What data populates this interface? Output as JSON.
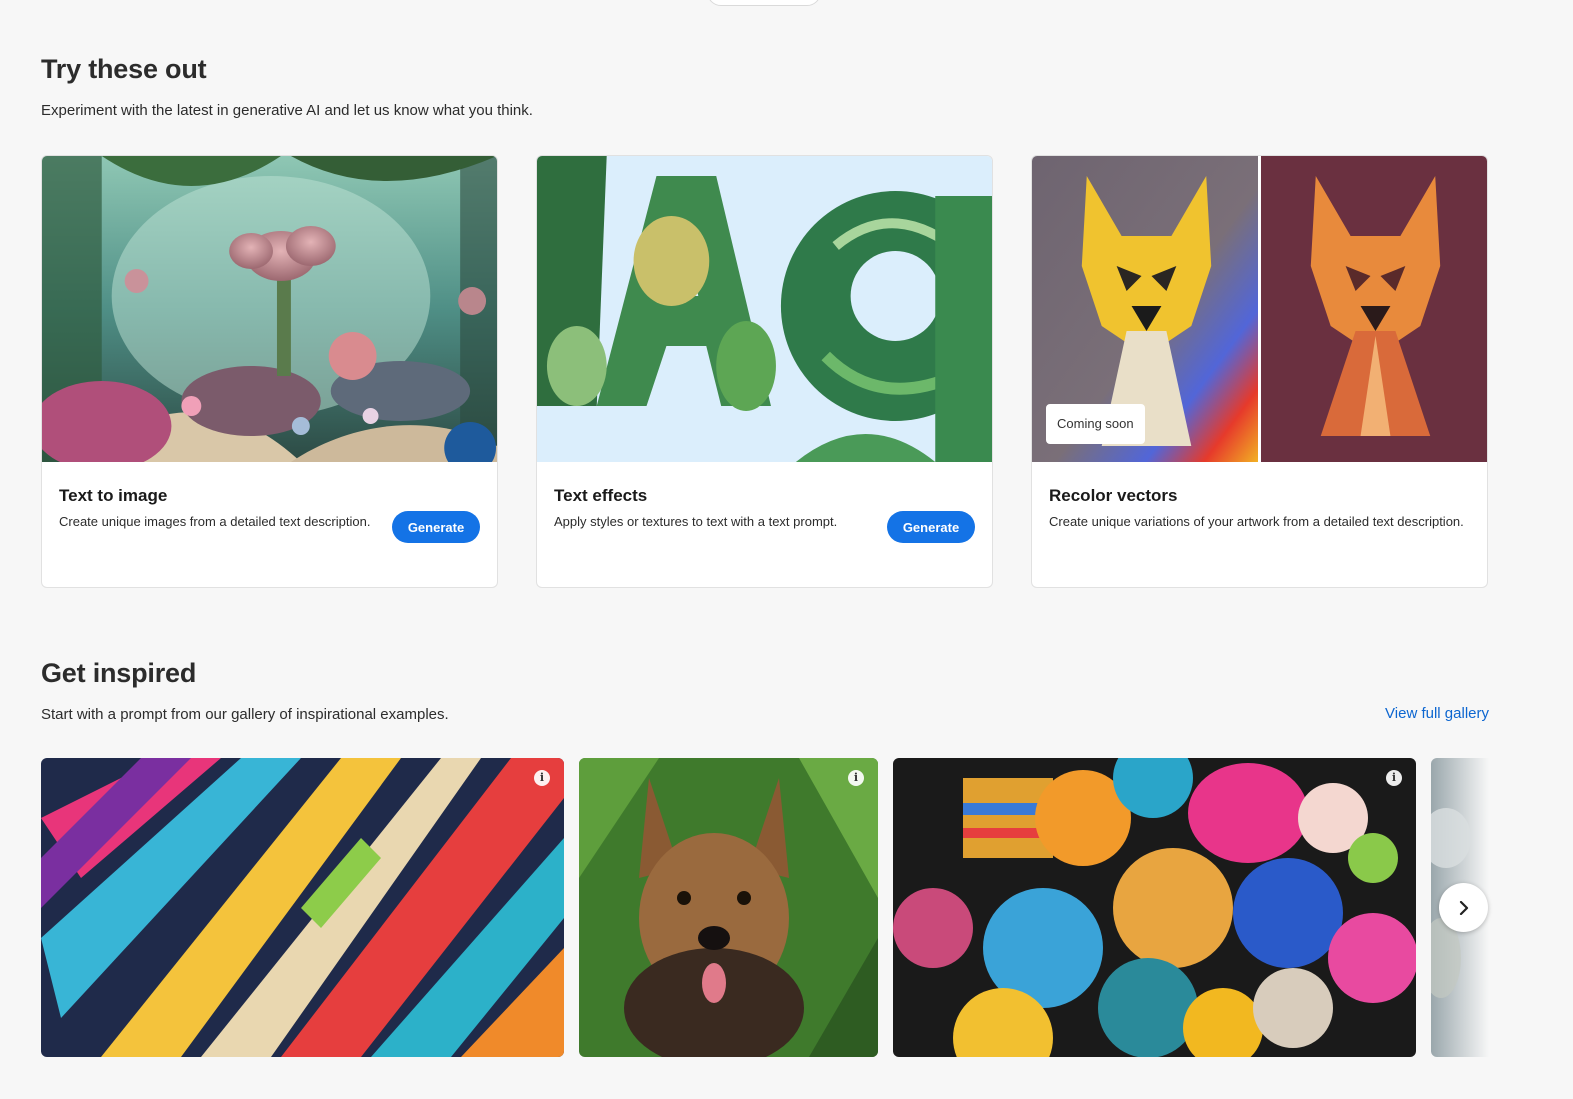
{
  "try_section": {
    "title": "Try these out",
    "subtitle": "Experiment with the latest in generative AI and let us know what you think.",
    "cards": [
      {
        "title": "Text to image",
        "description": "Create unique images from a detailed text description.",
        "button_label": "Generate",
        "image_icon": "fantasy-garden-image"
      },
      {
        "title": "Text effects",
        "description": "Apply styles or textures to text with a text prompt.",
        "button_label": "Generate",
        "image_icon": "leafy-letters-image"
      },
      {
        "title": "Recolor vectors",
        "description": "Create unique variations of your artwork from a detailed text description.",
        "badge": "Coming soon",
        "image_icon": "geometric-dog-image"
      }
    ]
  },
  "inspired_section": {
    "title": "Get inspired",
    "subtitle": "Start with a prompt from our gallery of inspirational examples.",
    "view_gallery_label": "View full gallery",
    "gallery": [
      {
        "image_icon": "abstract-ribbons-image",
        "info_icon": "info-icon"
      },
      {
        "image_icon": "terrier-in-ferns-image",
        "info_icon": "info-icon"
      },
      {
        "image_icon": "colorful-spheres-image",
        "info_icon": "info-icon"
      },
      {
        "image_icon": "cloudy-landscape-image"
      }
    ],
    "next_icon": "chevron-right-icon"
  },
  "colors": {
    "background": "#f7f7f7",
    "accent": "#1473e6",
    "link": "#0d66d0"
  }
}
